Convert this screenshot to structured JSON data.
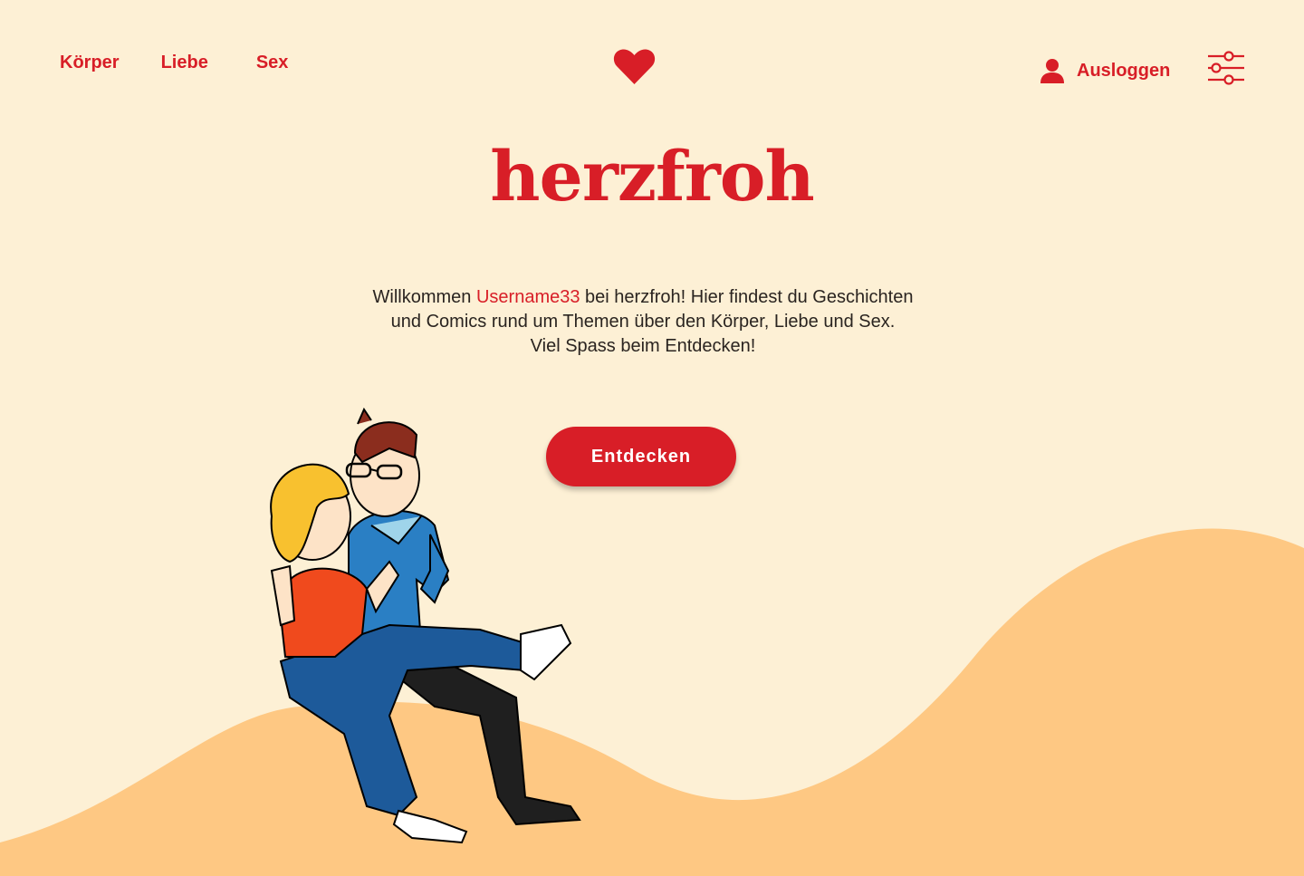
{
  "nav": {
    "items": [
      {
        "label": "Körper"
      },
      {
        "label": "Liebe"
      },
      {
        "label": "Sex"
      }
    ]
  },
  "header": {
    "logo_icon": "heart-icon",
    "logout_label": "Ausloggen",
    "user_icon": "user-icon",
    "settings_icon": "sliders-icon"
  },
  "hero": {
    "brand": "herzfroh",
    "welcome_prefix": "Willkommen ",
    "username": "Username33",
    "welcome_line1_rest": " bei herzfroh! Hier findest du Geschichten",
    "welcome_line2": "und Comics rund um Themen über den Körper, Liebe und Sex.",
    "welcome_line3": "Viel Spass beim Entdecken!",
    "cta_label": "Entdecken"
  },
  "colors": {
    "background": "#fdf0d5",
    "accent": "#d81e27",
    "hill": "#fec883"
  }
}
